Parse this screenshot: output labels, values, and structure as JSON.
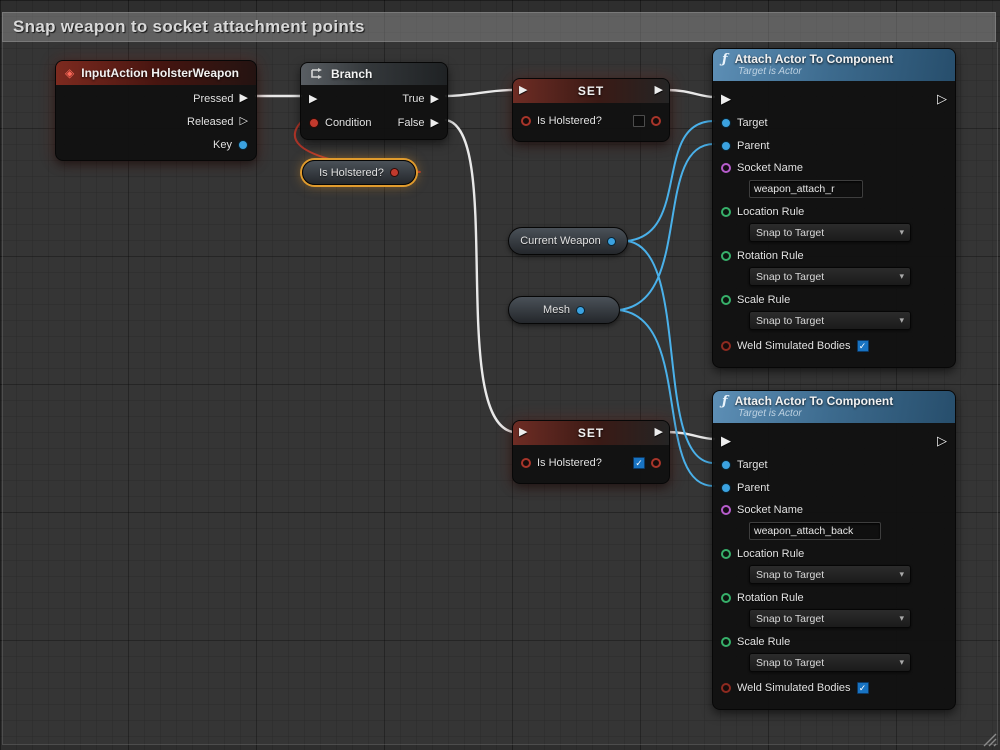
{
  "comment": {
    "title": "Snap weapon to socket attachment points"
  },
  "colors": {
    "exec_wire": "#e9e9e9",
    "object_wire": "#4ab1ea",
    "bool_wire": "#b5372a",
    "object_pin": "#3ba2e0",
    "bool_pin": "#c23a2d",
    "name_pin": "#b65ccb",
    "enum_pin": "#37b06a",
    "selection_outline": "#e09b2d",
    "event_header": "#7d2a1f",
    "function_header": "#4a7fa6",
    "checkbox_checked": "#1873c2"
  },
  "nodes": {
    "input_action": {
      "title": "InputAction HolsterWeapon",
      "pins": {
        "pressed": "Pressed",
        "released": "Released",
        "key": "Key"
      }
    },
    "branch": {
      "title": "Branch",
      "condition": "Condition",
      "true_label": "True",
      "false_label": "False"
    },
    "is_holstered_getter": {
      "label": "Is Holstered?"
    },
    "set_false": {
      "title": "SET",
      "field": "Is Holstered?",
      "checked": false
    },
    "set_true": {
      "title": "SET",
      "field": "Is Holstered?",
      "checked": true
    },
    "current_weapon_getter": {
      "label": "Current Weapon"
    },
    "mesh_getter": {
      "label": "Mesh"
    },
    "attach_right": {
      "title": "Attach Actor To Component",
      "subtitle": "Target is Actor",
      "target": "Target",
      "parent": "Parent",
      "socket_name_label": "Socket Name",
      "socket_name_value": "weapon_attach_r",
      "location_rule_label": "Location Rule",
      "location_rule_value": "Snap to Target",
      "rotation_rule_label": "Rotation Rule",
      "rotation_rule_value": "Snap to Target",
      "scale_rule_label": "Scale Rule",
      "scale_rule_value": "Snap to Target",
      "weld_label": "Weld Simulated Bodies",
      "weld_checked": true
    },
    "attach_back": {
      "title": "Attach Actor To Component",
      "subtitle": "Target is Actor",
      "target": "Target",
      "parent": "Parent",
      "socket_name_label": "Socket Name",
      "socket_name_value": "weapon_attach_back",
      "location_rule_label": "Location Rule",
      "location_rule_value": "Snap to Target",
      "rotation_rule_label": "Rotation Rule",
      "rotation_rule_value": "Snap to Target",
      "scale_rule_label": "Scale Rule",
      "scale_rule_value": "Snap to Target",
      "weld_label": "Weld Simulated Bodies",
      "weld_checked": true
    }
  }
}
